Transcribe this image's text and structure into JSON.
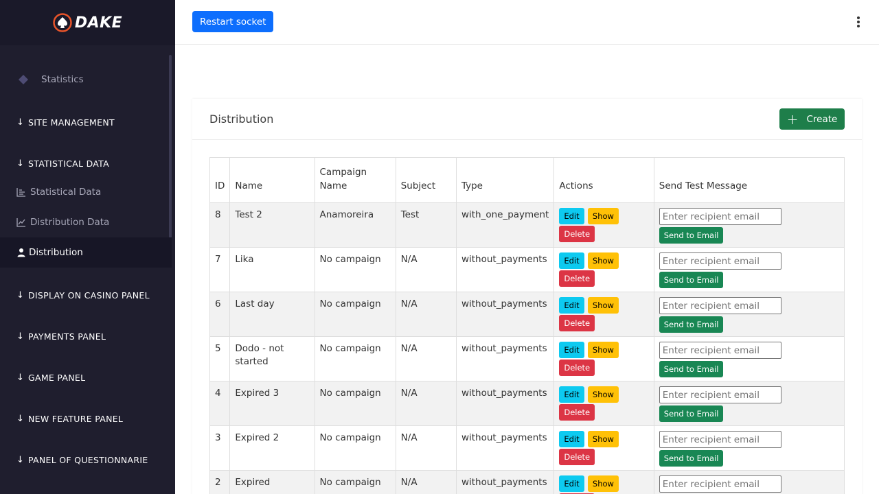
{
  "brand": {
    "name": "DAKE",
    "accent": "#e8542a"
  },
  "sidebar": {
    "top_item": {
      "label": "Statistics",
      "icon": "diamond-icon"
    },
    "sections": [
      {
        "label": "SITE MANAGEMENT"
      },
      {
        "label": "STATISTICAL DATA"
      },
      {
        "label": "DISPLAY ON CASINO PANEL"
      },
      {
        "label": "PAYMENTS PANEL"
      },
      {
        "label": "GAME PANEL"
      },
      {
        "label": "NEW FEATURE PANEL"
      },
      {
        "label": "PANEL OF QUESTIONNARIE"
      }
    ],
    "sub_items": [
      {
        "label": "Statistical Data",
        "icon": "bar-chart-icon"
      },
      {
        "label": "Distribution Data",
        "icon": "line-chart-icon"
      },
      {
        "label": "Distribution",
        "icon": "user-icon",
        "active": true
      }
    ]
  },
  "topbar": {
    "restart_label": "Restart socket"
  },
  "card": {
    "title": "Distribution",
    "create_label": "Create"
  },
  "table": {
    "headers": [
      "ID",
      "Name",
      "Campaign Name",
      "Subject",
      "Type",
      "Actions",
      "Send Test Message"
    ],
    "actions": {
      "edit": "Edit",
      "show": "Show",
      "delete": "Delete",
      "send": "Send to Email",
      "email_placeholder": "Enter recipient email"
    },
    "rows": [
      {
        "id": "8",
        "name": "Test 2",
        "campaign": "Anamoreira",
        "subject": "Test",
        "type": "with_one_payment"
      },
      {
        "id": "7",
        "name": "Lika",
        "campaign": "No campaign",
        "subject": "N/A",
        "type": "without_payments"
      },
      {
        "id": "6",
        "name": "Last day",
        "campaign": "No campaign",
        "subject": "N/A",
        "type": "without_payments"
      },
      {
        "id": "5",
        "name": "Dodo - not started",
        "campaign": "No campaign",
        "subject": "N/A",
        "type": "without_payments"
      },
      {
        "id": "4",
        "name": "Expired 3",
        "campaign": "No campaign",
        "subject": "N/A",
        "type": "without_payments"
      },
      {
        "id": "3",
        "name": "Expired 2",
        "campaign": "No campaign",
        "subject": "N/A",
        "type": "without_payments"
      },
      {
        "id": "2",
        "name": "Expired",
        "campaign": "No campaign",
        "subject": "N/A",
        "type": "without_payments"
      }
    ]
  }
}
